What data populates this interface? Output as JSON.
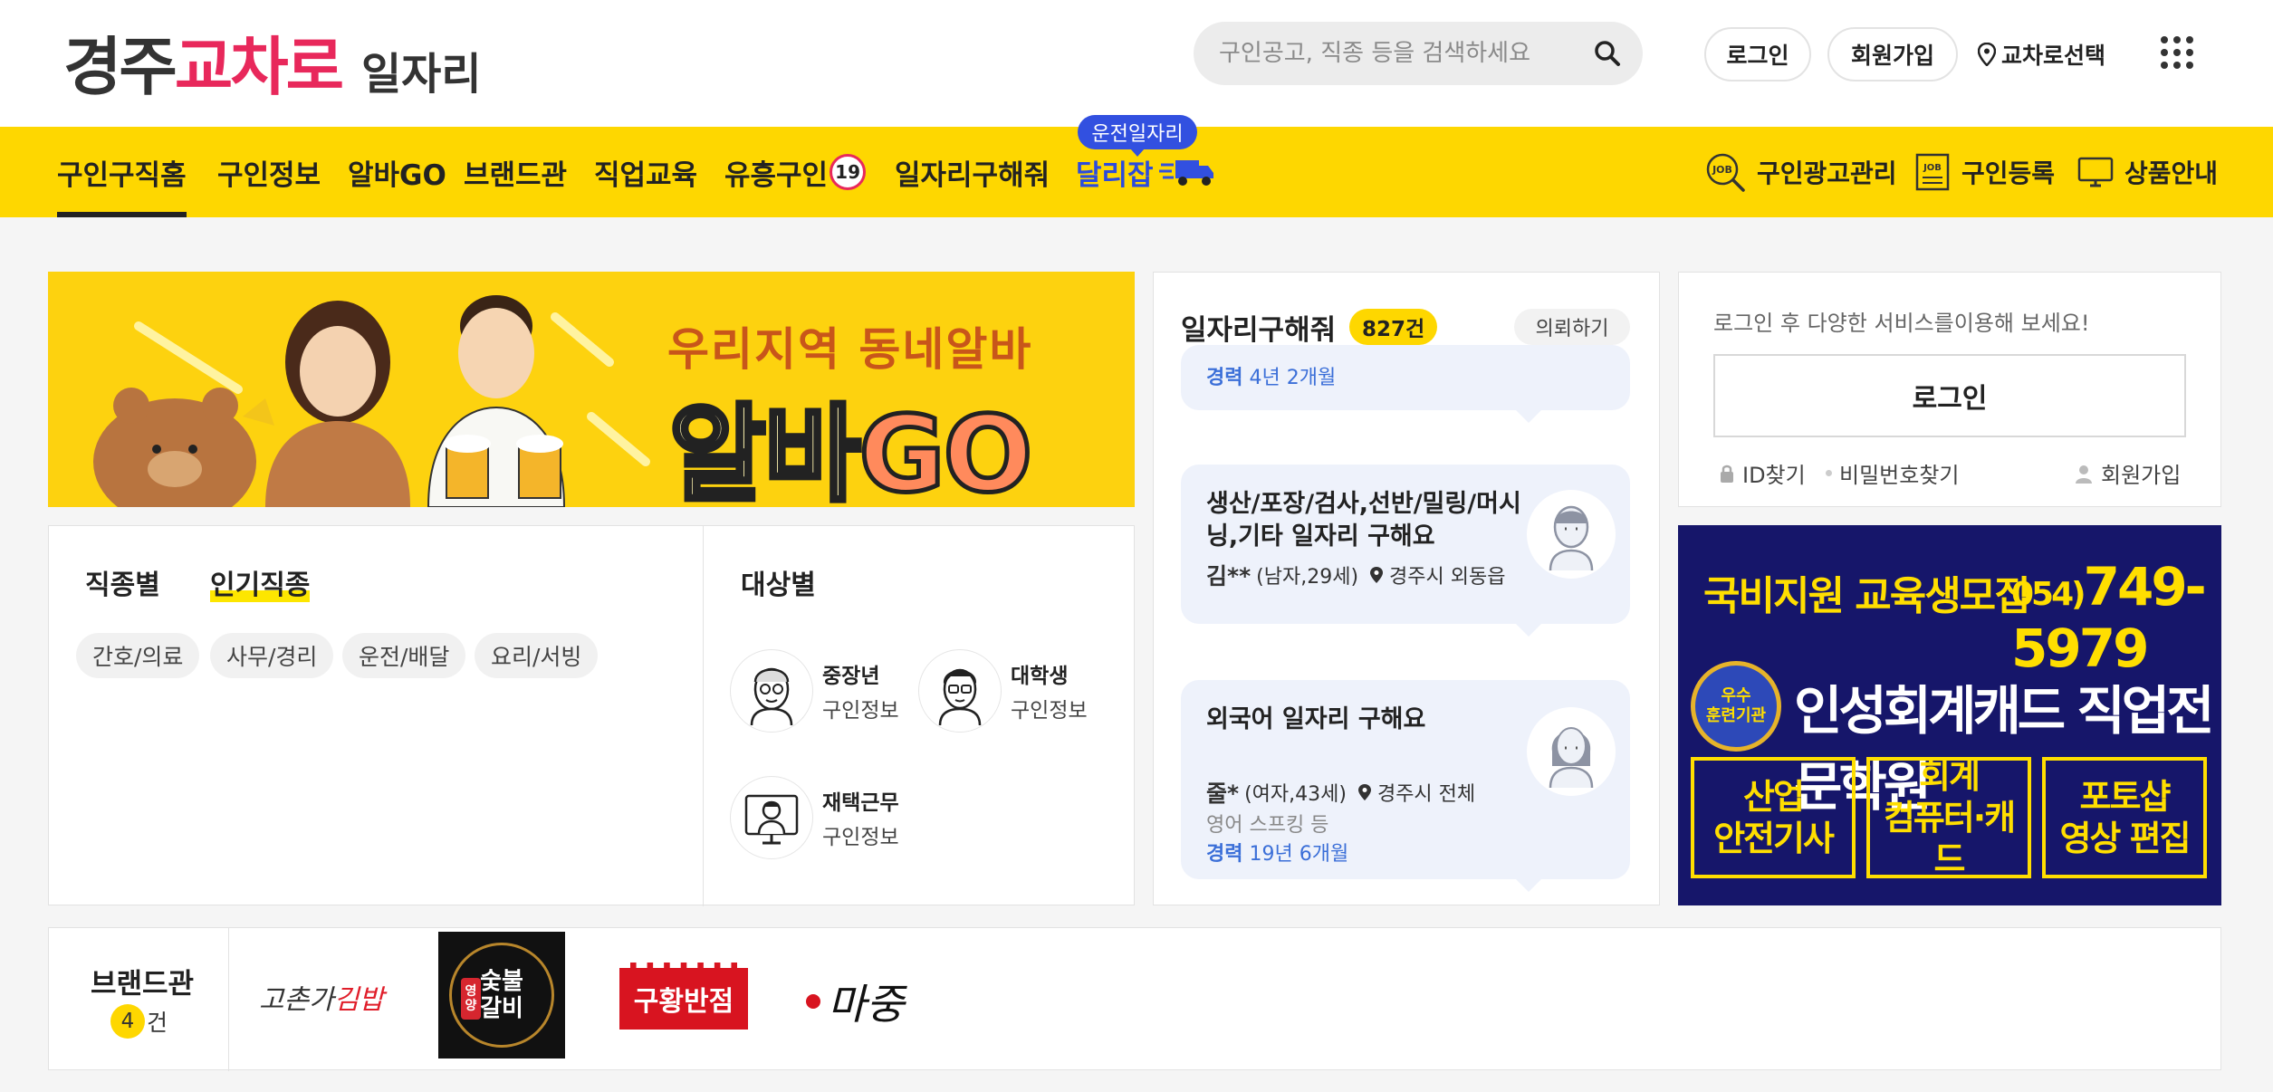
{
  "header": {
    "logo": {
      "part1": "경주",
      "part2": "교차로",
      "part3": "일자리"
    },
    "search": {
      "placeholder": "구인공고, 직종 등을 검색하세요"
    },
    "login_label": "로그인",
    "join_label": "회원가입",
    "region_label": "교차로선택"
  },
  "nav": {
    "items": [
      "구인구직홈",
      "구인정보",
      "알바GO",
      "브랜드관",
      "직업교육",
      "유흥구인",
      "일자리구해줘",
      "달리잡"
    ],
    "adult_badge": "19",
    "driver_tag": "운전일자리",
    "right_items": [
      "구인광고관리",
      "구인등록",
      "상품안내"
    ]
  },
  "banner": {
    "sub": "우리지역 동네알바",
    "big_a": "알바",
    "big_b": "GO"
  },
  "categories": {
    "tabs": [
      "직종별",
      "인기직종"
    ],
    "chips": [
      "간호/의료",
      "사무/경리",
      "운전/배달",
      "요리/서빙"
    ],
    "target_title": "대상별",
    "targets": [
      {
        "name": "중장년",
        "sub": "구인정보"
      },
      {
        "name": "대학생",
        "sub": "구인정보"
      },
      {
        "name": "재택근무",
        "sub": "구인정보"
      }
    ]
  },
  "jobs": {
    "title": "일자리구해줘",
    "count": "827건",
    "ask_label": "의뢰하기",
    "partial_exp": {
      "label": "경력",
      "value": "4년 2개월"
    },
    "cards": [
      {
        "title": "생산/포장/검사,선반/밀링/머시닝,기타 일자리 구해요",
        "name": "김**",
        "info": "(남자,29세)",
        "location": "경주시 외동읍"
      },
      {
        "title": "외국어 일자리 구해요",
        "name": "줄*",
        "info": "(여자,43세)",
        "location": "경주시 전체",
        "skill": "영어 스프킹 등",
        "exp_label": "경력",
        "exp_value": "19년 6개월"
      }
    ]
  },
  "login": {
    "message": "로그인 후 다양한 서비스를이용해 보세요!",
    "button": "로그인",
    "find_id": "ID찾기",
    "find_pw": "비밀번호찾기",
    "join": "회원가입"
  },
  "ad": {
    "line1": "국비지원 교육생모집",
    "phone_prefix": "054)",
    "phone": "749-5979",
    "seal_top": "우수",
    "seal_bottom": "훈련기관",
    "school": "인성회계캐드 직업전문학원",
    "boxes": [
      {
        "l1": "산업",
        "l2": "안전기사"
      },
      {
        "l1": "회계",
        "l2": "컴퓨터·캐드"
      },
      {
        "l1": "포토샵",
        "l2": "영상 편집"
      }
    ]
  },
  "brands": {
    "title": "브랜드관",
    "count": "4",
    "count_unit": "건",
    "brand1_a": "고촌가",
    "brand1_b": "김밥",
    "brand2_tag": "영양",
    "brand2_l1": "숯불",
    "brand2_l2": "갈비",
    "brand3": "구황반점",
    "brand4": "마중"
  },
  "colors": {
    "accent_yellow": "#fed700",
    "brand_pink": "#e8285b",
    "link_blue": "#3b6fd8",
    "ad_navy": "#16166a"
  }
}
